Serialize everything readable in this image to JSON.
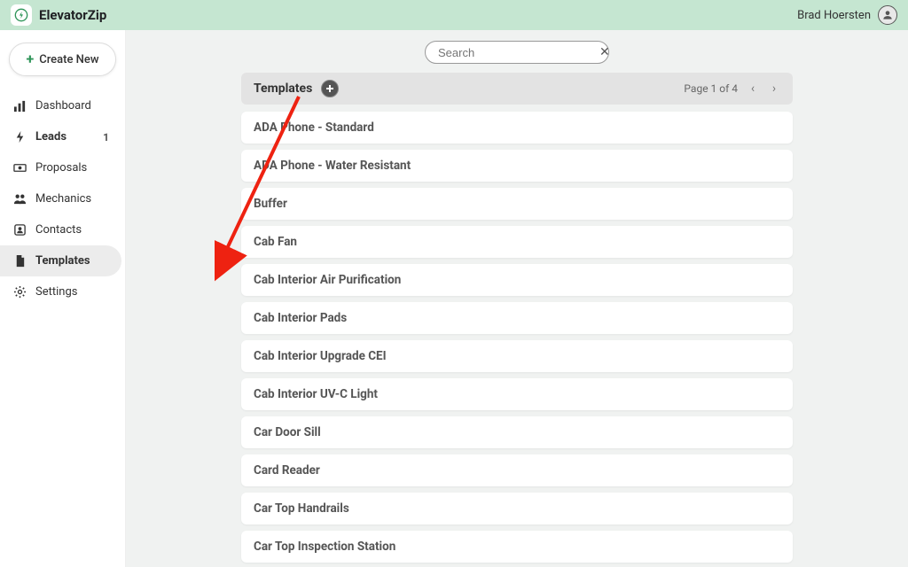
{
  "brand": {
    "name": "ElevatorZip"
  },
  "user": {
    "name": "Brad Hoersten"
  },
  "sidebar": {
    "create_label": "Create New",
    "items": [
      {
        "label": "Dashboard",
        "badge": ""
      },
      {
        "label": "Leads",
        "badge": "1"
      },
      {
        "label": "Proposals",
        "badge": ""
      },
      {
        "label": "Mechanics",
        "badge": ""
      },
      {
        "label": "Contacts",
        "badge": ""
      },
      {
        "label": "Templates",
        "badge": ""
      },
      {
        "label": "Settings",
        "badge": ""
      }
    ]
  },
  "search": {
    "placeholder": "Search"
  },
  "list": {
    "title": "Templates",
    "page_text": "Page 1 of 4",
    "rows": [
      "ADA Phone - Standard",
      "ADA Phone - Water Resistant",
      "Buffer",
      "Cab Fan",
      "Cab Interior Air Purification",
      "Cab Interior Pads",
      "Cab Interior Upgrade CEI",
      "Cab Interior UV-C Light",
      "Car Door Sill",
      "Card Reader",
      "Car Top Handrails",
      "Car Top Inspection Station"
    ]
  }
}
